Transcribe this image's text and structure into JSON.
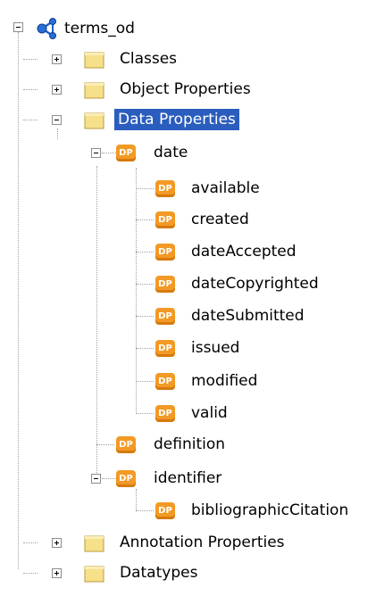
{
  "tree": {
    "root": {
      "label": "terms_od",
      "icon": "ontology-icon",
      "expanded": true
    },
    "folders": {
      "classes": {
        "label": "Classes",
        "icon": "folder-icon",
        "expanded": false
      },
      "object_properties": {
        "label": "Object Properties",
        "icon": "folder-icon",
        "expanded": false
      },
      "data_properties": {
        "label": "Data Properties",
        "icon": "folder-icon",
        "expanded": true,
        "selected": true
      },
      "annotation_properties": {
        "label": "Annotation Properties",
        "icon": "folder-icon",
        "expanded": false
      },
      "datatypes": {
        "label": "Datatypes",
        "icon": "folder-icon",
        "expanded": false
      }
    },
    "data_properties": {
      "badge": "DP",
      "date": {
        "label": "date",
        "expanded": true,
        "children": [
          "available",
          "created",
          "dateAccepted",
          "dateCopyrighted",
          "dateSubmitted",
          "issued",
          "modified",
          "valid"
        ]
      },
      "definition": {
        "label": "definition"
      },
      "identifier": {
        "label": "identifier",
        "expanded": true,
        "children": [
          "bibliographicCitation"
        ]
      }
    }
  },
  "colors": {
    "selection": "#2a5dbe",
    "dp_badge": "#f29a25",
    "folder": "#f6e08a",
    "tree_line": "#a0a0a0"
  }
}
